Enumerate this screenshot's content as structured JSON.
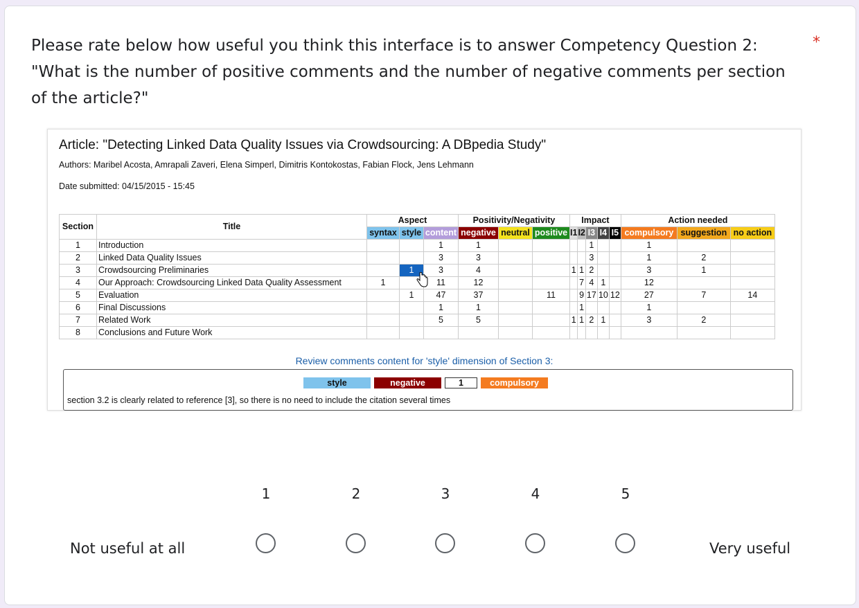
{
  "question": {
    "lines": [
      "Please rate below how useful you think this interface is to answer Competency Question 2:",
      "\"What is the number of positive comments and the number of negative comments per section",
      "of the article?\""
    ],
    "required_mark": "*"
  },
  "screenshot": {
    "article_title": "Article: \"Detecting Linked Data Quality Issues via Crowdsourcing: A DBpedia Study\"",
    "authors": "Authors: Maribel Acosta, Amrapali Zaveri, Elena Simperl, Dimitris Kontokostas, Fabian Flock, Jens Lehmann",
    "date": "Date submitted: 04/15/2015 - 15:45",
    "groups": {
      "section": "Section",
      "title": "Title",
      "aspect": "Aspect",
      "posneg": "Positivity/Negativity",
      "impact": "Impact",
      "action": "Action needed"
    },
    "subheaders": {
      "syntax": "syntax",
      "style": "style",
      "content": "content",
      "negative": "negative",
      "neutral": "neutral",
      "positive": "positive",
      "i1": "I1",
      "i2": "I2",
      "i3": "I3",
      "i4": "I4",
      "i5": "I5",
      "compulsory": "compulsory",
      "suggestion": "suggestion",
      "noaction": "no action"
    },
    "rows": [
      {
        "section": "1",
        "title": "Introduction",
        "syntax": "",
        "style": "",
        "content": "1",
        "negative": "1",
        "neutral": "",
        "positive": "",
        "i1": "",
        "i2": "",
        "i3": "1",
        "i4": "",
        "i5": "",
        "compulsory": "1",
        "suggestion": "",
        "noaction": ""
      },
      {
        "section": "2",
        "title": "Linked Data Quality Issues",
        "syntax": "",
        "style": "",
        "content": "3",
        "negative": "3",
        "neutral": "",
        "positive": "",
        "i1": "",
        "i2": "",
        "i3": "3",
        "i4": "",
        "i5": "",
        "compulsory": "1",
        "suggestion": "2",
        "noaction": ""
      },
      {
        "section": "3",
        "title": "Crowdsourcing Preliminaries",
        "syntax": "",
        "style": "1",
        "content": "3",
        "negative": "4",
        "neutral": "",
        "positive": "",
        "i1": "1",
        "i2": "1",
        "i3": "2",
        "i4": "",
        "i5": "",
        "compulsory": "3",
        "suggestion": "1",
        "noaction": ""
      },
      {
        "section": "4",
        "title": "Our Approach: Crowdsourcing Linked Data Quality Assessment",
        "syntax": "1",
        "style": "",
        "content": "11",
        "negative": "12",
        "neutral": "",
        "positive": "",
        "i1": "",
        "i2": "7",
        "i3": "4",
        "i4": "1",
        "i5": "",
        "compulsory": "12",
        "suggestion": "",
        "noaction": ""
      },
      {
        "section": "5",
        "title": "Evaluation",
        "syntax": "",
        "style": "1",
        "content": "47",
        "negative": "37",
        "neutral": "",
        "positive": "11",
        "i1": "",
        "i2": "9",
        "i3": "17",
        "i4": "10",
        "i5": "12",
        "compulsory": "27",
        "suggestion": "7",
        "noaction": "14"
      },
      {
        "section": "6",
        "title": "Final Discussions",
        "syntax": "",
        "style": "",
        "content": "1",
        "negative": "1",
        "neutral": "",
        "positive": "",
        "i1": "",
        "i2": "1",
        "i3": "",
        "i4": "",
        "i5": "",
        "compulsory": "1",
        "suggestion": "",
        "noaction": ""
      },
      {
        "section": "7",
        "title": "Related Work",
        "syntax": "",
        "style": "",
        "content": "5",
        "negative": "5",
        "neutral": "",
        "positive": "",
        "i1": "1",
        "i2": "1",
        "i3": "2",
        "i4": "1",
        "i5": "",
        "compulsory": "3",
        "suggestion": "2",
        "noaction": ""
      },
      {
        "section": "8",
        "title": "Conclusions and Future Work",
        "syntax": "",
        "style": "",
        "content": "",
        "negative": "",
        "neutral": "",
        "positive": "",
        "i1": "",
        "i2": "",
        "i3": "",
        "i4": "",
        "i5": "",
        "compulsory": "",
        "suggestion": "",
        "noaction": ""
      }
    ],
    "review_link": "Review comments content for 'style' dimension of Section 3:",
    "review_chips": {
      "aspect": "style",
      "polarity": "negative",
      "impact": "1",
      "action": "compulsory"
    },
    "review_comment": "section 3.2 is clearly related to reference [3], so there is no need to include the citation several times"
  },
  "scale": {
    "options": [
      "1",
      "2",
      "3",
      "4",
      "5"
    ],
    "low_label": "Not useful at all",
    "high_label": "Very useful"
  }
}
